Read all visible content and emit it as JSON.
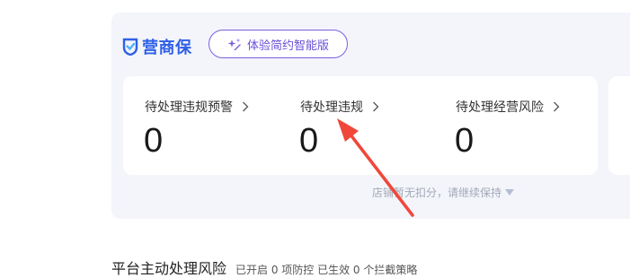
{
  "brand": {
    "name": "营商保",
    "icon": "shield-check-icon",
    "color": "#2f5fe8"
  },
  "trial_button": {
    "label": "体验简约智能版",
    "icon": "sparkle-icon",
    "color": "#6a4fd8"
  },
  "metrics": [
    {
      "label": "待处理违规预警",
      "value": "0"
    },
    {
      "label": "待处理违规",
      "value": "0"
    },
    {
      "label": "待处理经营风险",
      "value": "0"
    }
  ],
  "note": {
    "text": "店铺暂无扣分，请继续保持",
    "icon": "caret-down-icon"
  },
  "section": {
    "title": "平台主动处理风险",
    "subtitle": "已开启 0 项防控 已生效 0 个拦截策略"
  },
  "annotation": {
    "icon": "red-arrow-icon",
    "color": "#f0473a"
  }
}
